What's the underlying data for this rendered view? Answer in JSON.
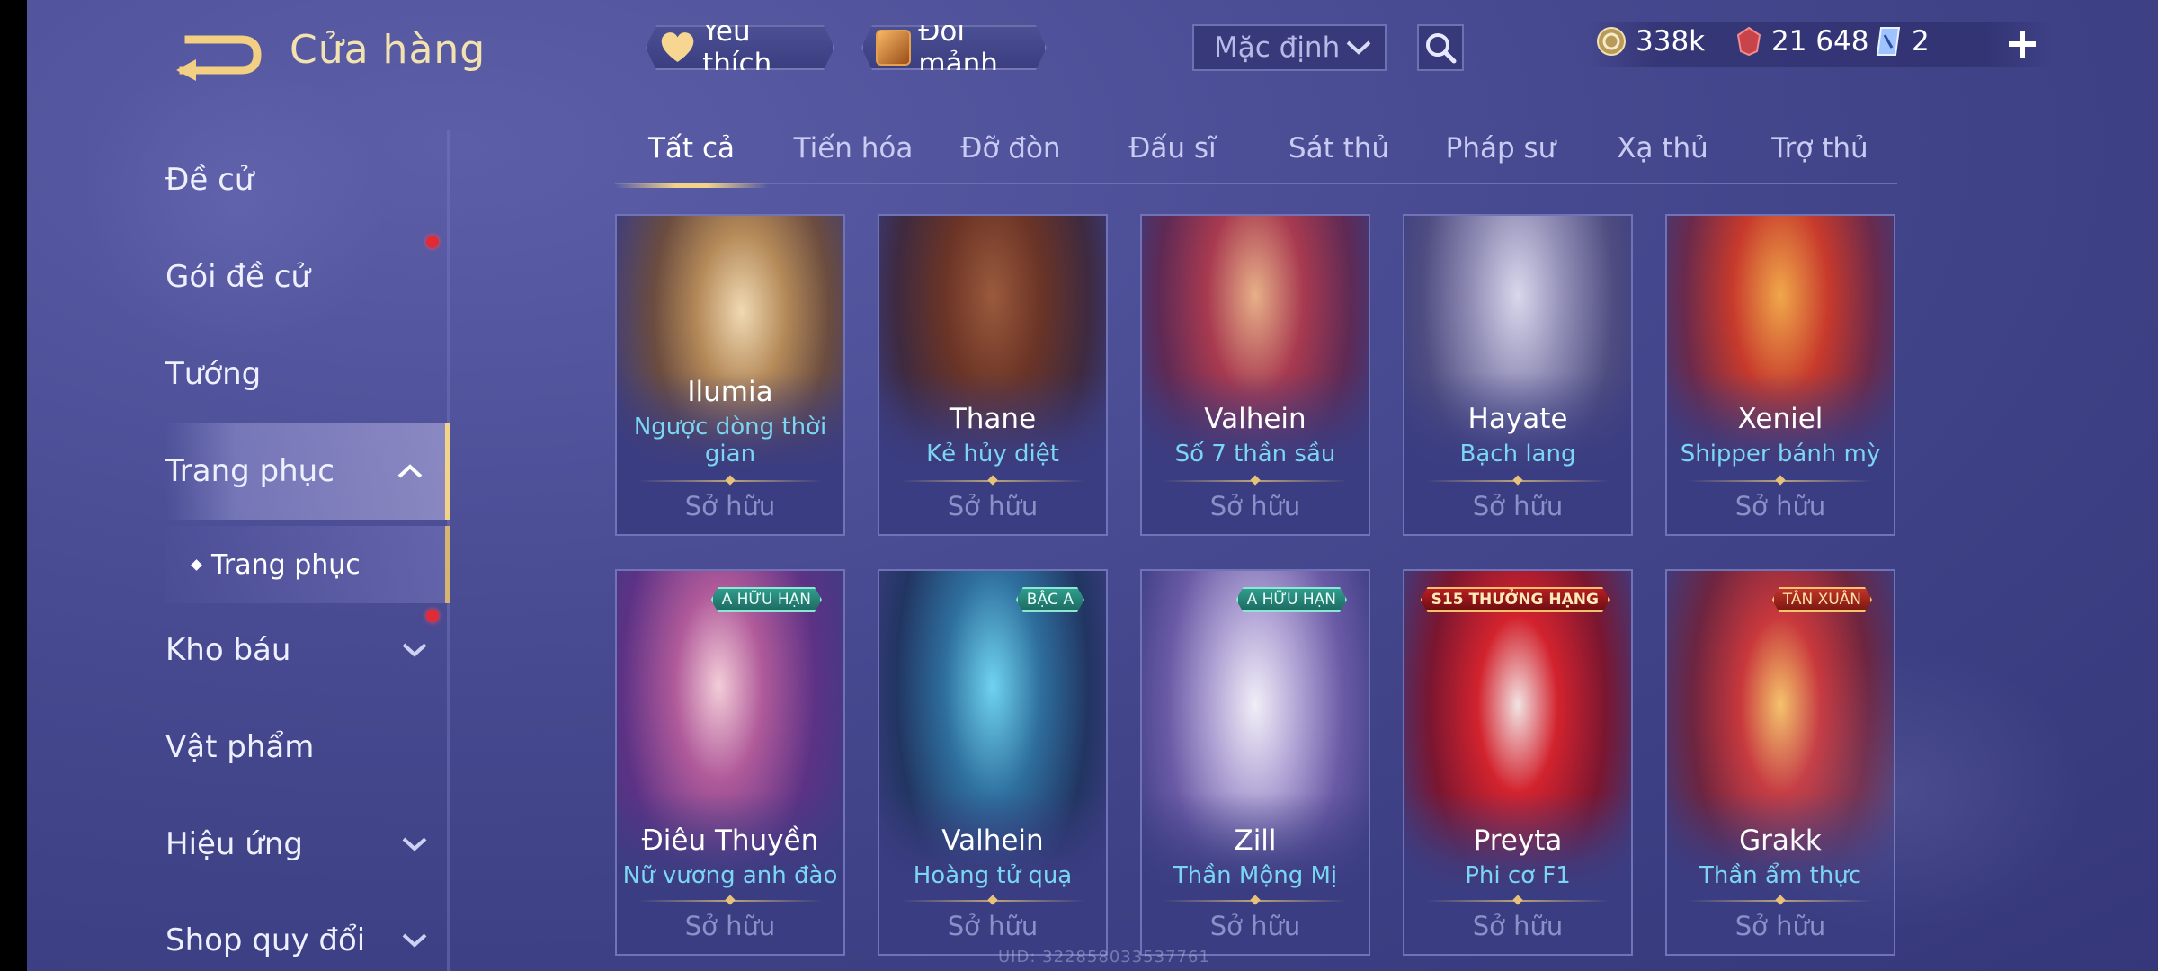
{
  "header": {
    "title": "Cửa hàng",
    "favorite_label": "Yêu thích",
    "shard_label": "Đổi mảnh",
    "sort_value": "Mặc định",
    "currencies": {
      "gold": "338k",
      "ruby": "21 648",
      "voucher": "2"
    }
  },
  "sidebar": {
    "items": [
      {
        "label": "Đề cử"
      },
      {
        "label": "Gói đề cử"
      },
      {
        "label": "Tướng"
      },
      {
        "label": "Trang phục"
      },
      {
        "label": "Kho báu"
      },
      {
        "label": "Vật phẩm"
      },
      {
        "label": "Hiệu ứng"
      },
      {
        "label": "Shop quy đổi"
      }
    ],
    "sub_item": "Trang phục"
  },
  "tabs": [
    "Tất cả",
    "Tiến hóa",
    "Đỡ đòn",
    "Đấu sĩ",
    "Sát thủ",
    "Pháp sư",
    "Xạ thủ",
    "Trợ thủ"
  ],
  "cards": [
    {
      "hero": "Ilumia",
      "skin": "Ngược dòng thời gian",
      "status": "Sở hữu",
      "badge": ""
    },
    {
      "hero": "Thane",
      "skin": "Kẻ hủy diệt",
      "status": "Sở hữu",
      "badge": ""
    },
    {
      "hero": "Valhein",
      "skin": "Số 7 thần sầu",
      "status": "Sở hữu",
      "badge": ""
    },
    {
      "hero": "Hayate",
      "skin": "Bạch lang",
      "status": "Sở hữu",
      "badge": ""
    },
    {
      "hero": "Xeniel",
      "skin": "Shipper bánh mỳ",
      "status": "Sở hữu",
      "badge": ""
    },
    {
      "hero": "Điêu Thuyền",
      "skin": "Nữ vương anh đào",
      "status": "Sở hữu",
      "badge": "A HỮU HẠN"
    },
    {
      "hero": "Valhein",
      "skin": "Hoàng tử quạ",
      "status": "Sở hữu",
      "badge": "BẬC A"
    },
    {
      "hero": "Zill",
      "skin": "Thần Mộng Mị",
      "status": "Sở hữu",
      "badge": "A HỮU HẠN"
    },
    {
      "hero": "Preyta",
      "skin": "Phi cơ F1",
      "status": "Sở hữu",
      "badge": "S15 THƯỞNG HẠNG"
    },
    {
      "hero": "Grakk",
      "skin": "Thần ẩm thực",
      "status": "Sở hữu",
      "badge": "TÂN XUÂN"
    }
  ],
  "uid_text": "UID: 322858033537761",
  "colors": {
    "accent_gold": "#f1d48a",
    "skin_name": "#7ad6f2",
    "notification": "#e02a35"
  },
  "icons": [
    "back-arrow-icon",
    "heart-icon",
    "shard-icon",
    "chevron-down-icon",
    "search-icon",
    "gold-coin-icon",
    "ruby-gem-icon",
    "voucher-icon",
    "plus-icon",
    "chevron-up-icon"
  ]
}
